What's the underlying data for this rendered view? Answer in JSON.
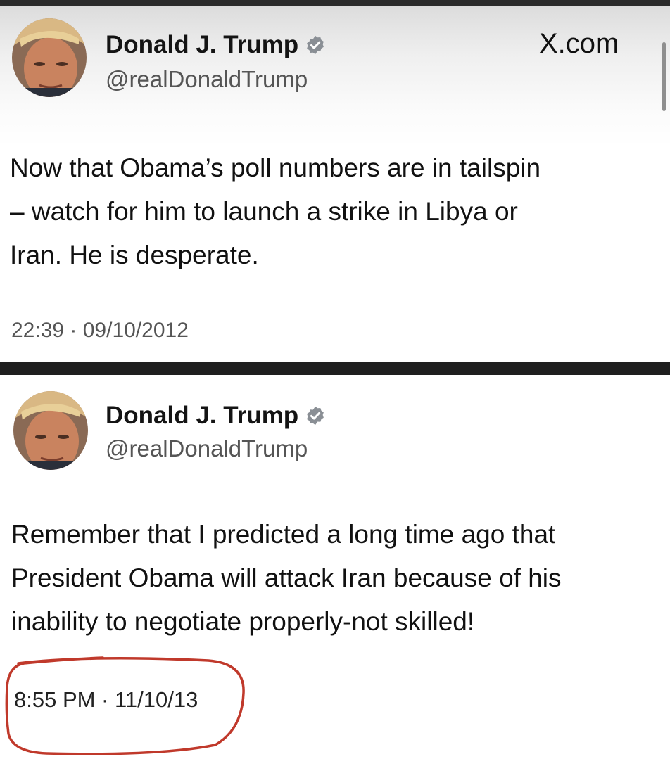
{
  "tweet1": {
    "display_name": "Donald J. Trump",
    "handle": "@realDonaldTrump",
    "source": "X.com",
    "text_lines": [
      "Now that Obama’s poll numbers are in tailspin",
      "– watch for him to launch a strike in Libya or",
      "Iran.  He is desperate."
    ],
    "timestamp": "22:39 · 09/10/2012"
  },
  "tweet2": {
    "display_name": "Donald J. Trump",
    "handle": "@realDonaldTrump",
    "text_lines": [
      "Remember that I predicted a long time ago that",
      "President Obama will attack Iran because of his",
      "inability to negotiate properly-not skilled!"
    ],
    "timestamp": "8:55 PM · 11/10/13"
  },
  "colors": {
    "verified_badge": "#8a8f95",
    "annotation_circle": "#c0392b",
    "divider": "#1f1f1f"
  },
  "icons": [
    "avatar-photo",
    "verified-badge-icon"
  ]
}
